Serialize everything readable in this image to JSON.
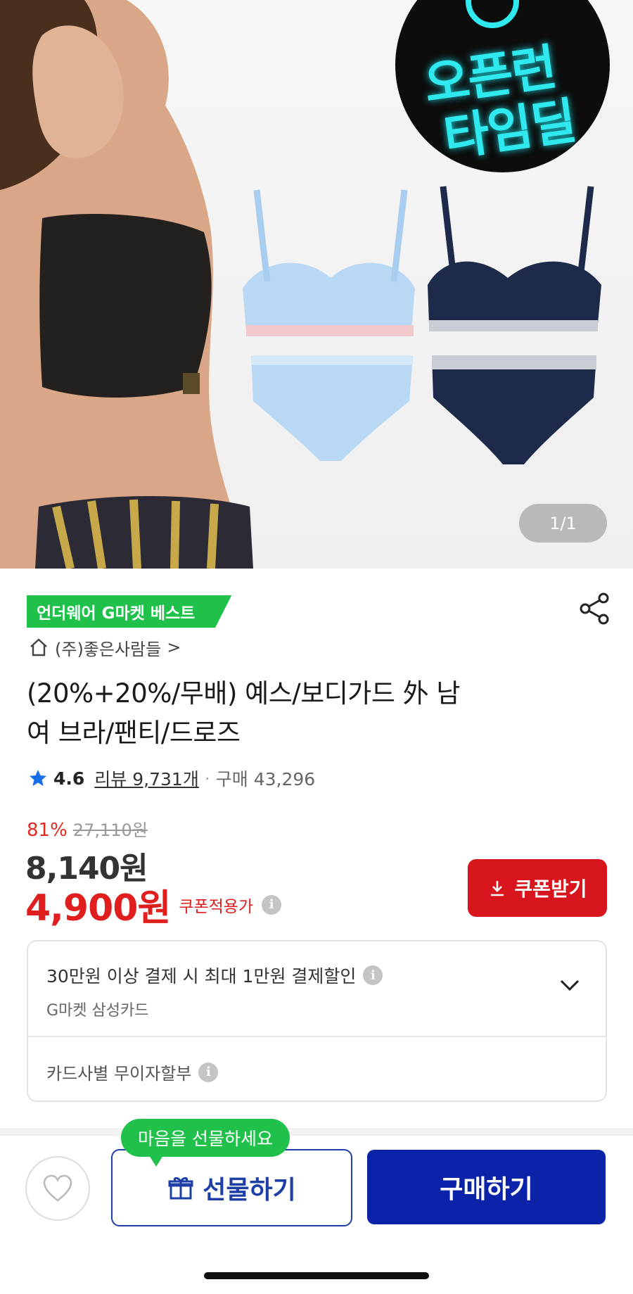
{
  "hero": {
    "page_counter": "1/1",
    "badge_line1": "오픈런",
    "badge_line2": "타임딜",
    "badge_icon": "alarm-clock-icon"
  },
  "product": {
    "best_badge": "언더웨어 G마켓 베스트",
    "seller": "(주)좋은사람들",
    "seller_arrow": ">",
    "title_line1": "(20%+20%/무배) 예스/보디가드 外 남",
    "title_line2": "여 브라/팬티/드로즈",
    "rating": "4.6",
    "review_label": "리뷰 9,731개",
    "separator": "·",
    "sales_label": "구매 43,296",
    "discount_pct": "81%",
    "original_price": "27,110원",
    "price": "8,140원",
    "coupon_price": "4,900원",
    "coupon_note": "쿠폰적용가",
    "coupon_button": "쿠폰받기"
  },
  "card_benefits": {
    "row1_title": "30만원 이상 결제 시 최대 1만원 결제할인",
    "row1_sub": "G마켓 삼성카드",
    "row2_title": "카드사별 무이자할부"
  },
  "bottom_bar": {
    "gift_tooltip": "마음을 선물하세요",
    "gift_button": "선물하기",
    "buy_button": "구매하기"
  },
  "colors": {
    "green_badge": "#1fc14a",
    "sale_red": "#e01e1e",
    "coupon_red": "#d8141c",
    "buy_blue": "#0a23a8",
    "gift_blue": "#1d3fa6",
    "star_blue": "#1a6fe6",
    "neon_cyan": "#2fe9ee"
  }
}
